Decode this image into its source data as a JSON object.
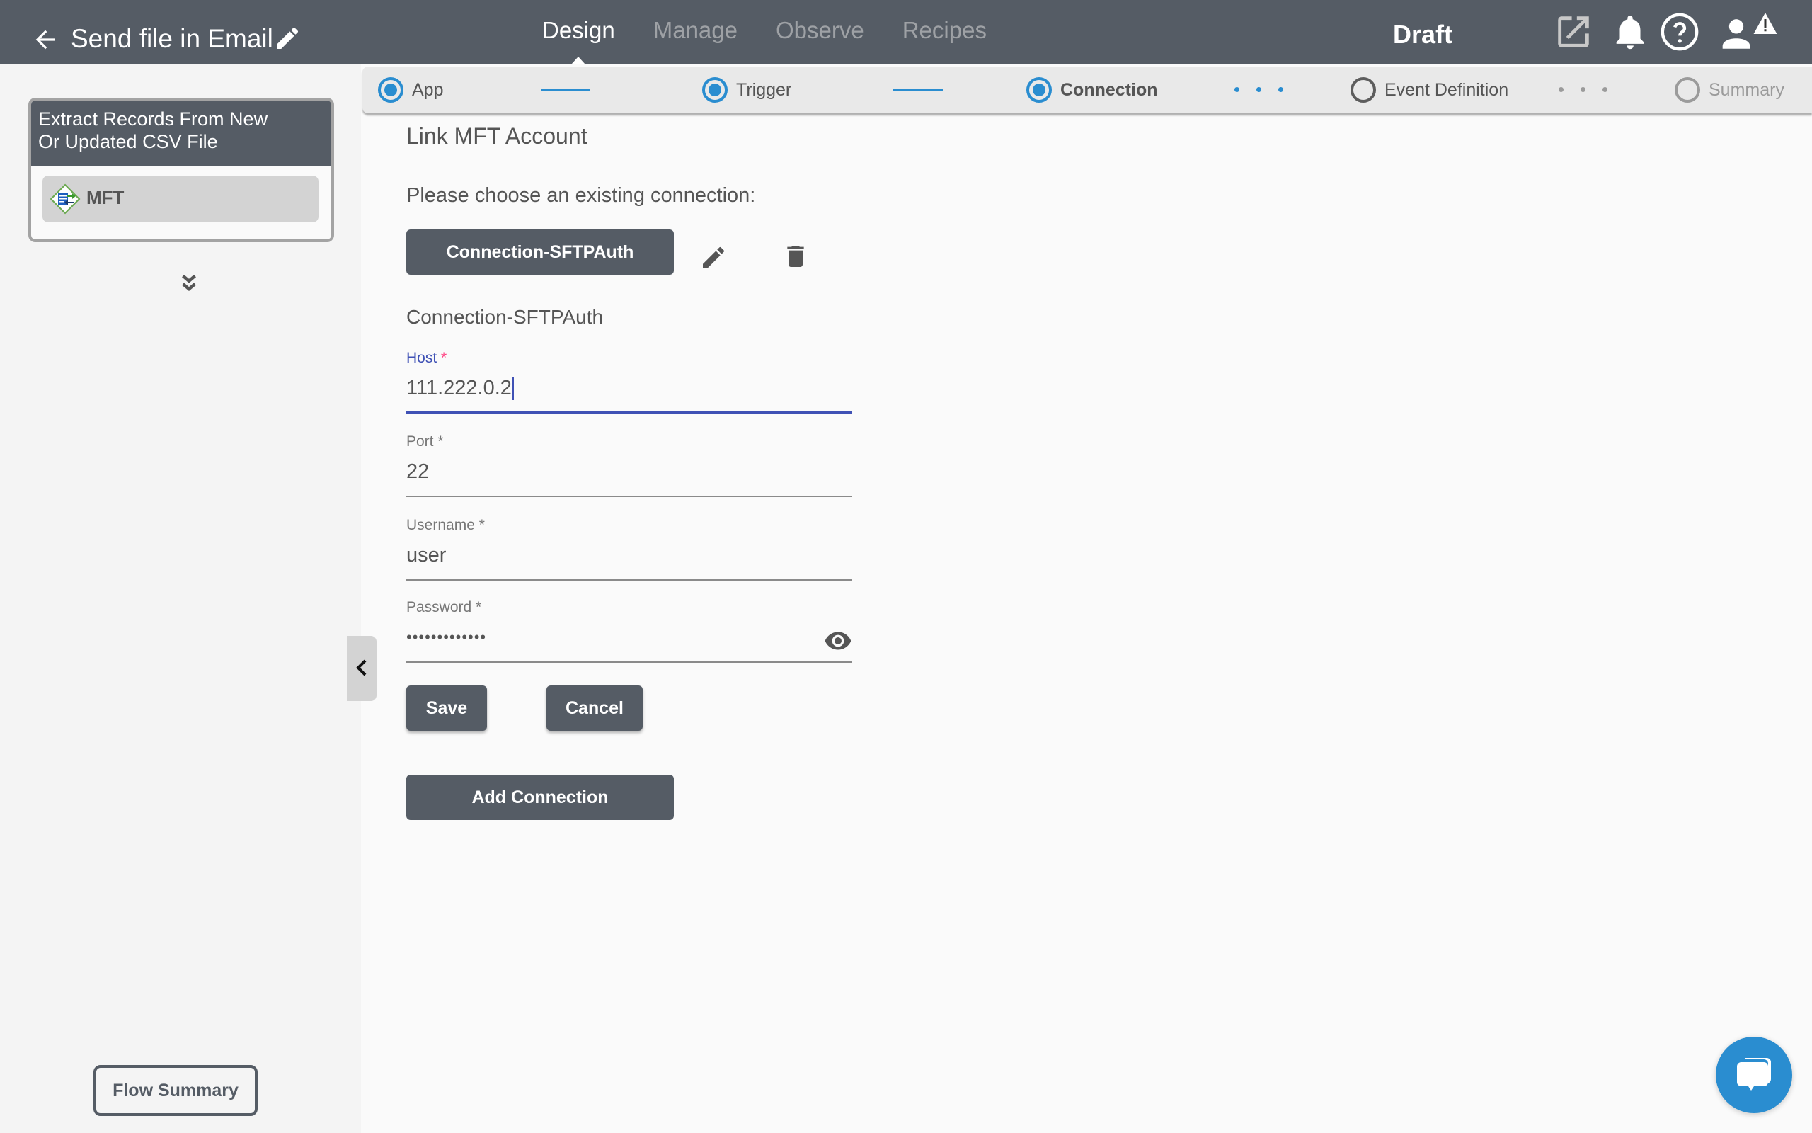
{
  "header": {
    "back_icon": "arrow-left-icon",
    "flow_title": "Send file in Email",
    "edit_icon": "pencil-icon",
    "nav_tabs": [
      {
        "label": "Design",
        "active": true
      },
      {
        "label": "Manage",
        "active": false
      },
      {
        "label": "Observe",
        "active": false
      },
      {
        "label": "Recipes",
        "active": false
      }
    ],
    "status": "Draft",
    "icons": [
      "external-link-icon",
      "bell-icon",
      "help-icon",
      "user-icon",
      "warning-icon"
    ]
  },
  "sidebar": {
    "step_card": {
      "title": "Extract Records From New Or Updated CSV File",
      "title_line1": "Extract Records From New",
      "title_line2": "Or Updated CSV File",
      "item_label": "MFT",
      "item_icon": "mft-app-icon"
    },
    "expand_icon": "double-chevron-down-icon",
    "flow_summary_label": "Flow Summary",
    "collapse_icon": "chevron-left-icon"
  },
  "stepper": {
    "steps": [
      {
        "label": "App",
        "state": "complete"
      },
      {
        "label": "Trigger",
        "state": "complete"
      },
      {
        "label": "Connection",
        "state": "current"
      },
      {
        "label": "Event Definition",
        "state": "pending"
      },
      {
        "label": "Summary",
        "state": "disabled"
      }
    ]
  },
  "main": {
    "title": "Link MFT Account",
    "choose_label": "Please choose an existing connection:",
    "selected_connection": "Connection-SFTPAuth",
    "connection_heading": "Connection-SFTPAuth",
    "fields": {
      "host": {
        "label": "Host",
        "required": "*",
        "value": "111.222.0.2"
      },
      "port": {
        "label": "Port",
        "required": "*",
        "value": "22"
      },
      "username": {
        "label": "Username",
        "required": "*",
        "value": "user"
      },
      "password": {
        "label": "Password",
        "required": "*",
        "value": "•••••••••••••"
      }
    },
    "save_label": "Save",
    "cancel_label": "Cancel",
    "add_connection_label": "Add Connection"
  },
  "colors": {
    "header_bg": "#555c65",
    "accent_blue": "#2a8dd0",
    "focus_indigo": "#3f51b5",
    "required_pink": "#ff4081"
  },
  "chat_icon": "chat-bubbles-icon"
}
